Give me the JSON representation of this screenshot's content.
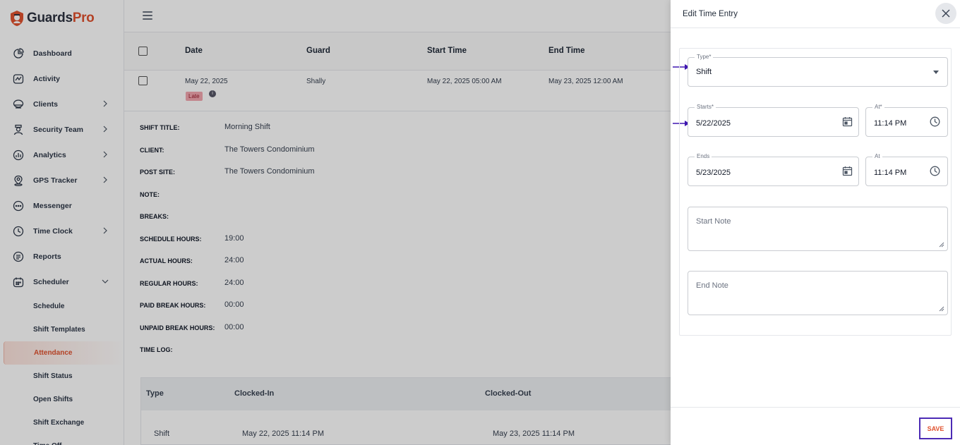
{
  "app": {
    "logo_brand": "Guards",
    "logo_suffix": "Pro"
  },
  "sidebar": {
    "items": [
      {
        "label": "Dashboard",
        "icon": "dashboard-icon",
        "chevron": false
      },
      {
        "label": "Activity",
        "icon": "activity-icon",
        "chevron": false
      },
      {
        "label": "Clients",
        "icon": "clients-icon",
        "chevron": true
      },
      {
        "label": "Security Team",
        "icon": "security-team-icon",
        "chevron": true
      },
      {
        "label": "Analytics",
        "icon": "analytics-icon",
        "chevron": true
      },
      {
        "label": "GPS Tracker",
        "icon": "gps-icon",
        "chevron": true
      },
      {
        "label": "Messenger",
        "icon": "messenger-icon",
        "chevron": false
      },
      {
        "label": "Time Clock",
        "icon": "clock-icon",
        "chevron": true
      },
      {
        "label": "Reports",
        "icon": "reports-icon",
        "chevron": false
      },
      {
        "label": "Scheduler",
        "icon": "calendar-icon",
        "chevron": true
      }
    ],
    "subitems": [
      "Schedule",
      "Shift Templates",
      "Attendance",
      "Shift Status",
      "Open Shifts",
      "Shift Exchange",
      "Time Off"
    ],
    "active_subitem": "Attendance"
  },
  "table": {
    "headers": {
      "date": "Date",
      "guard": "Guard",
      "start": "Start Time",
      "end": "End Time"
    },
    "row": {
      "date": "May 22, 2025",
      "badge": "Late",
      "guard": "Shally",
      "start": "May 22, 2025 05:00 AM",
      "end": "May 23, 2025 12:00 AM"
    }
  },
  "details": {
    "shift_title_label": "SHIFT TITLE:",
    "shift_title": "Morning Shift",
    "client_label": "CLIENT:",
    "client": "The Towers Condominium",
    "post_site_label": "POST SITE:",
    "post_site": "The Towers Condominium",
    "note_label": "NOTE:",
    "breaks_label": "BREAKS:",
    "schedule_hours_label": "SCHEDULE HOURS:",
    "schedule_hours": "19:00",
    "actual_hours_label": "ACTUAL HOURS:",
    "actual_hours": "24:00",
    "regular_hours_label": "REGULAR HOURS:",
    "regular_hours": "24:00",
    "paid_break_label": "PAID BREAK HOURS:",
    "paid_break": "00:00",
    "unpaid_break_label": "UNPAID BREAK HOURS:",
    "unpaid_break": "00:00",
    "time_log_label": "TIME LOG:"
  },
  "time_log": {
    "headers": {
      "type": "Type",
      "in": "Clocked-In",
      "out": "Clocked-Out"
    },
    "row": {
      "type": "Shift",
      "in": "May 22, 2025 11:14 PM",
      "out": "May 23, 2025 11:14 PM"
    }
  },
  "panel": {
    "title": "Edit Time Entry",
    "type_label": "Type*",
    "type_value": "Shift",
    "starts_label": "Starts*",
    "starts_value": "5/22/2025",
    "start_at_label": "At*",
    "start_at_value": "11:14 PM",
    "ends_label": "Ends",
    "ends_value": "5/23/2025",
    "end_at_label": "At",
    "end_at_value": "11:14 PM",
    "start_note_placeholder": "Start Note",
    "end_note_placeholder": "End Note",
    "save_label": "SAVE"
  },
  "colors": {
    "accent": "#e0522f",
    "highlight": "#4c2bb5",
    "late_badge": "#f3a7b0"
  }
}
